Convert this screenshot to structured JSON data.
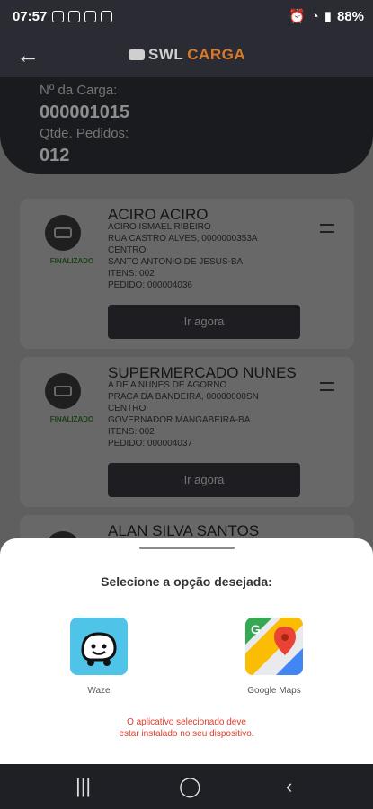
{
  "status_bar": {
    "time": "07:57",
    "battery": "88%"
  },
  "header": {
    "brand_part1": "SWL",
    "brand_part2": "CARGA",
    "carga_label": "Nº da Carga:",
    "carga_number": "000001015",
    "pedidos_label": "Qtde. Pedidos:",
    "pedidos_count": "012"
  },
  "deliveries": [
    {
      "name": "ACIRO ACIRO",
      "contact": "ACIRO ISMAEL RIBEIRO",
      "address": "RUA CASTRO ALVES, 0000000353A",
      "district": "CENTRO",
      "city": "SANTO ANTONIO DE JESUS-BA",
      "items": "ITENS: 002",
      "order": "PEDIDO: 000004036",
      "status": "FINALIZADO",
      "button": "Ir agora"
    },
    {
      "name": "SUPERMERCADO NUNES",
      "contact": "A DE A NUNES DE AGORNO",
      "address": "PRACA DA BANDEIRA, 00000000SN",
      "district": "CENTRO",
      "city": "GOVERNADOR MANGABEIRA-BA",
      "items": "ITENS: 002",
      "order": "PEDIDO: 000004037",
      "status": "FINALIZADO",
      "button": "Ir agora"
    },
    {
      "name": "ALAN SILVA SANTOS"
    }
  ],
  "sheet": {
    "title": "Selecione a opção desejada:",
    "apps": [
      {
        "label": "Waze",
        "icon": "waze-icon"
      },
      {
        "label": "Google Maps",
        "icon": "google-maps-icon"
      }
    ],
    "warning_line1": "O aplicativo selecionado deve",
    "warning_line2": "estar instalado no seu dispositivo."
  },
  "colors": {
    "dark": "#2b2c33",
    "accent": "#d97a2a",
    "finalized": "#2a6a2a",
    "warning": "#e03a2a",
    "waze": "#4fc3e8"
  }
}
